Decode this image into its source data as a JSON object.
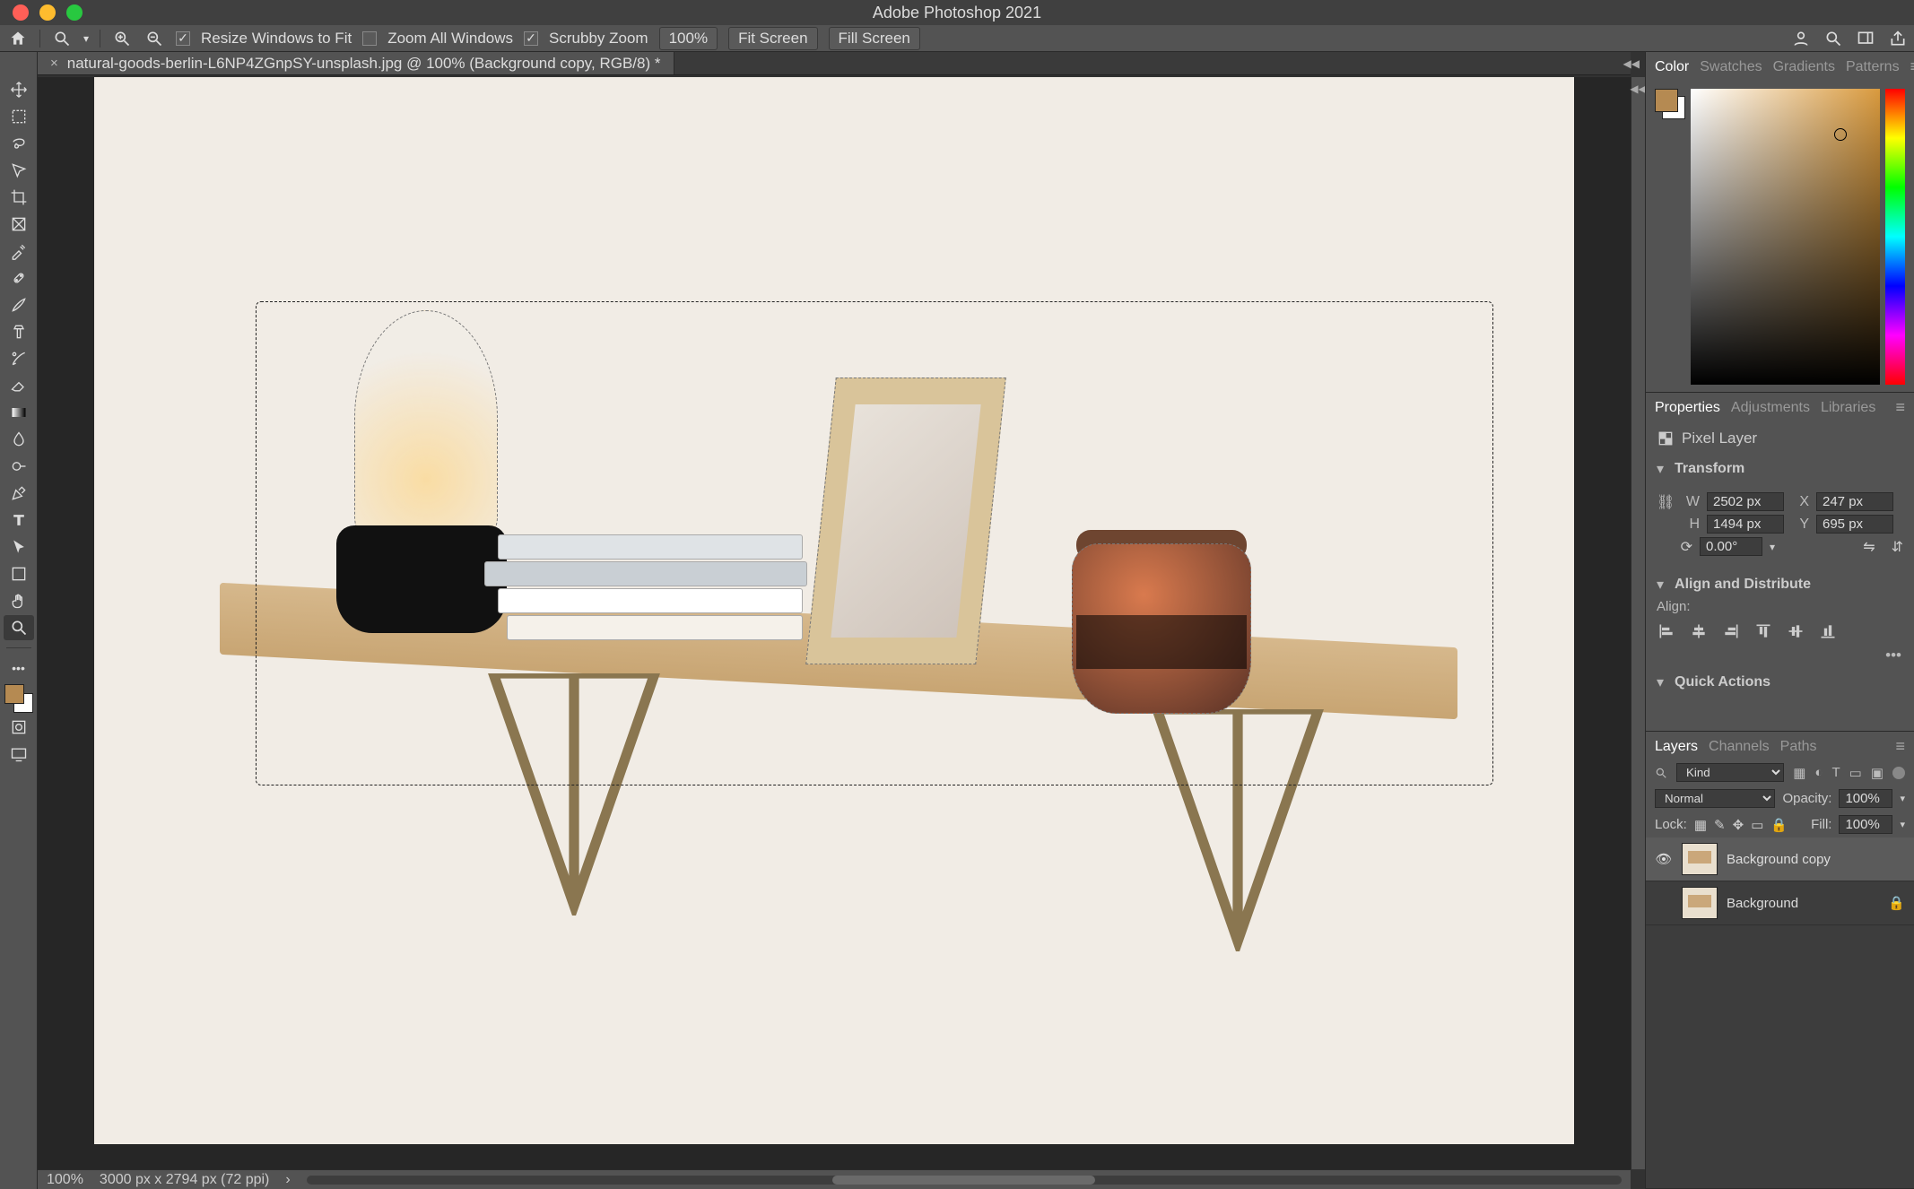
{
  "app": {
    "title": "Adobe Photoshop 2021"
  },
  "options": {
    "resize_windows": "Resize Windows to Fit",
    "zoom_all": "Zoom All Windows",
    "scrubby": "Scrubby Zoom",
    "zoom_pct": "100%",
    "fit": "Fit Screen",
    "fill": "Fill Screen",
    "resize_checked": true,
    "zoom_all_checked": false,
    "scrubby_checked": true
  },
  "document": {
    "tab_title": "natural-goods-berlin-L6NP4ZGnpSY-unsplash.jpg @ 100% (Background copy, RGB/8) *"
  },
  "status": {
    "zoom": "100%",
    "dims": "3000 px x 2794 px (72 ppi)"
  },
  "tools": [
    "move-tool",
    "marquee-tool",
    "lasso-tool",
    "quick-select-tool",
    "crop-tool",
    "frame-tool",
    "eyedropper-tool",
    "healing-tool",
    "brush-tool",
    "clone-tool",
    "history-brush-tool",
    "eraser-tool",
    "gradient-tool",
    "blur-tool",
    "dodge-tool",
    "pen-tool",
    "type-tool",
    "path-select-tool",
    "shape-tool",
    "hand-tool",
    "zoom-tool"
  ],
  "colors": {
    "foreground": "#b58a52",
    "background": "#ffffff"
  },
  "panels": {
    "color": {
      "tabs": [
        "Color",
        "Swatches",
        "Gradients",
        "Patterns"
      ],
      "active": 0
    },
    "properties": {
      "tabs": [
        "Properties",
        "Adjustments",
        "Libraries"
      ],
      "active": 0,
      "type_label": "Pixel Layer",
      "transform_label": "Transform",
      "W": "2502 px",
      "H": "1494 px",
      "X": "247 px",
      "Y": "695 px",
      "angle": "0.00°",
      "align_label": "Align and Distribute",
      "align_sub": "Align:",
      "quick_actions": "Quick Actions"
    },
    "layers": {
      "tabs": [
        "Layers",
        "Channels",
        "Paths"
      ],
      "active": 0,
      "kind": "Kind",
      "blend": "Normal",
      "opacity_label": "Opacity:",
      "opacity": "100%",
      "lock_label": "Lock:",
      "fill_label": "Fill:",
      "fill": "100%",
      "items": [
        {
          "name": "Background copy",
          "visible": true,
          "locked": false
        },
        {
          "name": "Background",
          "visible": true,
          "locked": true
        }
      ]
    }
  }
}
